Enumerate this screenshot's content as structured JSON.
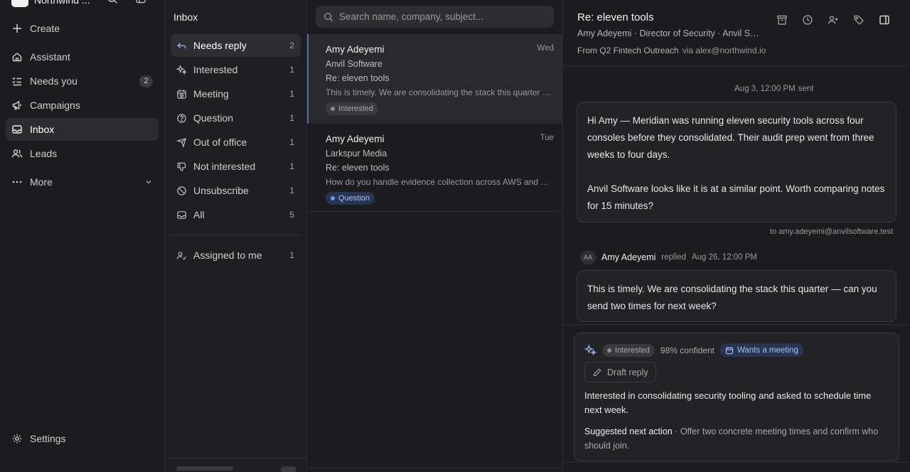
{
  "sidebar": {
    "brand": "Northwind ...",
    "create": "Create",
    "items": [
      {
        "label": "Assistant",
        "icon": "home-icon"
      },
      {
        "label": "Needs you",
        "icon": "checklist-icon",
        "badge": "2"
      },
      {
        "label": "Campaigns",
        "icon": "megaphone-icon"
      },
      {
        "label": "Inbox",
        "icon": "inbox-icon",
        "active": true
      },
      {
        "label": "Leads",
        "icon": "users-icon"
      },
      {
        "label": "More",
        "icon": "more-icon"
      }
    ],
    "settings": "Settings"
  },
  "folders": {
    "title": "Inbox",
    "items": [
      {
        "label": "Needs reply",
        "count": "2",
        "icon": "reply-icon"
      },
      {
        "label": "Interested",
        "count": "1",
        "icon": "sparkle-icon"
      },
      {
        "label": "Meeting",
        "count": "1",
        "icon": "calendar-clock-icon"
      },
      {
        "label": "Question",
        "count": "1",
        "icon": "question-icon"
      },
      {
        "label": "Out of office",
        "count": "1",
        "icon": "plane-icon"
      },
      {
        "label": "Not interested",
        "count": "1",
        "icon": "thumbs-down-icon"
      },
      {
        "label": "Unsubscribe",
        "count": "1",
        "icon": "ban-icon"
      },
      {
        "label": "All",
        "count": "5",
        "icon": "inbox-icon"
      }
    ],
    "assigned": {
      "label": "Assigned to me",
      "count": "1"
    }
  },
  "list": {
    "search_placeholder": "Search name, company, subject...",
    "messages": [
      {
        "name": "Amy Adeyemi",
        "day": "Wed",
        "company": "Anvil Software",
        "subject": "Re: eleven tools",
        "snippet": "This is timely. We are consolidating the stack this quarter — can you send two times for next week?",
        "tag": "Interested"
      },
      {
        "name": "Amy Adeyemi",
        "day": "Tue",
        "company": "Larkspur Media",
        "subject": "Re: eleven tools",
        "snippet": "How do you handle evidence collection across AWS and Okta without manual exports?",
        "tag": "Question"
      }
    ]
  },
  "detail": {
    "title": "Re: eleven tools",
    "subtitle": "Amy Adeyemi · Director of Security · Anvil Software",
    "from_label": "From Q2 Fintech Outreach",
    "via": "via alex@northwind.io",
    "sent_time": "Aug 3, 12:00 PM",
    "sent_label": "sent",
    "outgoing_p1": "Hi Amy — Meridian was running eleven security tools across four consoles before they consolidated. Their audit prep went from three weeks to four days.",
    "outgoing_p2": "Anvil Software looks like it is at a similar point. Worth comparing notes for 15 minutes?",
    "to_line": "to amy.adeyemi@anvilsoftware.test",
    "reply_initials": "AA",
    "reply_name": "Amy Adeyemi",
    "reply_verb": "replied",
    "reply_time": "Aug 26, 12:00 PM",
    "reply_body": "This is timely. We are consolidating the stack this quarter — can you send two times for next week?",
    "ai": {
      "tag": "Interested",
      "confidence": "98% confident",
      "intent": "Wants a meeting",
      "draft_label": "Draft reply",
      "summary": "Interested in consolidating security tooling and asked to schedule time next week.",
      "next_key": "Suggested next action",
      "next_sep": " · ",
      "next_value": "Offer two concrete meeting times and confirm who should join."
    }
  }
}
